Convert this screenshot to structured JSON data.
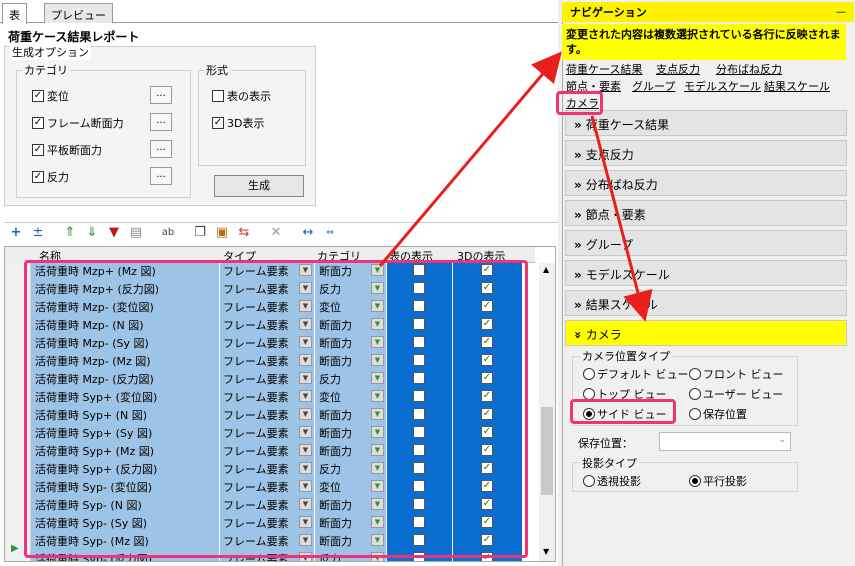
{
  "tabs": [
    "表",
    "プレビュー"
  ],
  "report_title": "荷重ケース結果レポート",
  "options": {
    "legend": "生成オプション",
    "category_legend": "カテゴリ",
    "format_legend": "形式",
    "categories": [
      {
        "label": "変位",
        "checked": true
      },
      {
        "label": "フレーム断面力",
        "checked": true
      },
      {
        "label": "平板断面力",
        "checked": true
      },
      {
        "label": "反力",
        "checked": true
      }
    ],
    "dots": "...",
    "formats": [
      {
        "label": "表の表示",
        "checked": false
      },
      {
        "label": "3D表示",
        "checked": true
      }
    ],
    "generate": "生成"
  },
  "columns": [
    "名称",
    "タイプ",
    "カテゴリ",
    "表の表示",
    "3Dの表示"
  ],
  "rows": [
    {
      "name": "活荷重時 Mzp+ (Mz 図)",
      "type": "フレーム要素",
      "cat": "断面力",
      "t": false,
      "d": true
    },
    {
      "name": "活荷重時 Mzp+ (反力図)",
      "type": "フレーム要素",
      "cat": "反力",
      "t": false,
      "d": true
    },
    {
      "name": "活荷重時 Mzp- (変位図)",
      "type": "フレーム要素",
      "cat": "変位",
      "t": false,
      "d": true
    },
    {
      "name": "活荷重時 Mzp- (N 図)",
      "type": "フレーム要素",
      "cat": "断面力",
      "t": false,
      "d": true
    },
    {
      "name": "活荷重時 Mzp- (Sy 図)",
      "type": "フレーム要素",
      "cat": "断面力",
      "t": false,
      "d": true
    },
    {
      "name": "活荷重時 Mzp- (Mz 図)",
      "type": "フレーム要素",
      "cat": "断面力",
      "t": false,
      "d": true
    },
    {
      "name": "活荷重時 Mzp- (反力図)",
      "type": "フレーム要素",
      "cat": "反力",
      "t": false,
      "d": true
    },
    {
      "name": "活荷重時 Syp+ (変位図)",
      "type": "フレーム要素",
      "cat": "変位",
      "t": false,
      "d": true
    },
    {
      "name": "活荷重時 Syp+ (N 図)",
      "type": "フレーム要素",
      "cat": "断面力",
      "t": false,
      "d": true
    },
    {
      "name": "活荷重時 Syp+ (Sy 図)",
      "type": "フレーム要素",
      "cat": "断面力",
      "t": false,
      "d": true
    },
    {
      "name": "活荷重時 Syp+ (Mz 図)",
      "type": "フレーム要素",
      "cat": "断面力",
      "t": false,
      "d": true
    },
    {
      "name": "活荷重時 Syp+ (反力図)",
      "type": "フレーム要素",
      "cat": "反力",
      "t": false,
      "d": true
    },
    {
      "name": "活荷重時 Syp- (変位図)",
      "type": "フレーム要素",
      "cat": "変位",
      "t": false,
      "d": true
    },
    {
      "name": "活荷重時 Syp- (N 図)",
      "type": "フレーム要素",
      "cat": "断面力",
      "t": false,
      "d": true
    },
    {
      "name": "活荷重時 Syp- (Sy 図)",
      "type": "フレーム要素",
      "cat": "断面力",
      "t": false,
      "d": true
    },
    {
      "name": "活荷重時 Syp- (Mz 図)",
      "type": "フレーム要素",
      "cat": "断面力",
      "t": false,
      "d": true
    },
    {
      "name": "活荷重時 Syp- (反力図)",
      "type": "フレーム要素",
      "cat": "反力",
      "t": false,
      "d": true
    }
  ],
  "nav": {
    "title": "ナビゲーション",
    "pin": "ᅳ",
    "warning": "変更された内容は複数選択されている各行に反映されます。",
    "links": [
      "荷重ケース結果",
      "支点反力",
      "分布ばね反力",
      "節点・要素",
      "グループ",
      "モデルスケール",
      "結果スケール",
      "カメラ"
    ],
    "sections": [
      "荷重ケース結果",
      "支点反力",
      "分布ばね反力",
      "節点・要素",
      "グループ",
      "モデルスケール",
      "結果スケール",
      "カメラ"
    ],
    "chev_closed": "»",
    "chev_open": "»",
    "camera": {
      "type_label": "カメラ位置タイプ",
      "types": [
        {
          "label": "デフォルト ビュー",
          "sel": false
        },
        {
          "label": "フロント ビュー",
          "sel": false
        },
        {
          "label": "トップ ビュー",
          "sel": false
        },
        {
          "label": "ユーザー ビュー",
          "sel": false
        },
        {
          "label": "サイド ビュー",
          "sel": true
        },
        {
          "label": "保存位置",
          "sel": false
        }
      ],
      "saved_label": "保存位置：",
      "proj_label": "投影タイプ",
      "proj": [
        {
          "label": "透視投影",
          "sel": false
        },
        {
          "label": "平行投影",
          "sel": true
        }
      ]
    }
  },
  "colors": {
    "highlight": "#f0327a",
    "arrow": "#e8201c",
    "selected": "#0a6ed1",
    "nav_yellow": "#ffff00"
  }
}
